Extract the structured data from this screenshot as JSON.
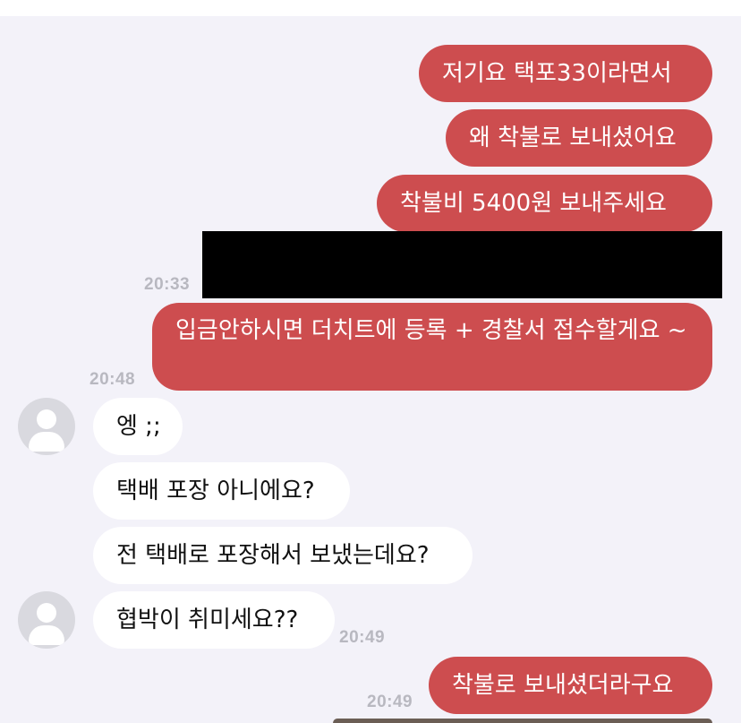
{
  "messages": [
    {
      "id": "m1",
      "text": "저기요 택포33이라면서"
    },
    {
      "id": "m2",
      "text": "왜 착불로 보내셨어요"
    },
    {
      "id": "m3",
      "text": "착불비 5400원 보내주세요"
    },
    {
      "id": "m4",
      "text": "입금안하시면 더치트에 등록 + 경찰서 접수할게요 ~"
    },
    {
      "id": "m5",
      "text": "엥 ;;"
    },
    {
      "id": "m6",
      "text": "택배 포장 아니에요?"
    },
    {
      "id": "m7",
      "text": "전 택배로 포장해서 보냈는데요?"
    },
    {
      "id": "m8",
      "text": "협박이 취미세요??"
    },
    {
      "id": "m9",
      "text": "착불로 보내셨더라구요"
    }
  ],
  "timestamps": {
    "t1": "20:33",
    "t2": "20:48",
    "t3": "20:49",
    "t4": "20:49"
  },
  "colors": {
    "outgoing_bubble": "#cd4d4f",
    "incoming_bubble": "#ffffff",
    "background": "#f3f2f9",
    "timestamp": "#b8b8c0",
    "redaction": "#000000"
  },
  "icons": {
    "avatar": "default-user-avatar-icon"
  }
}
